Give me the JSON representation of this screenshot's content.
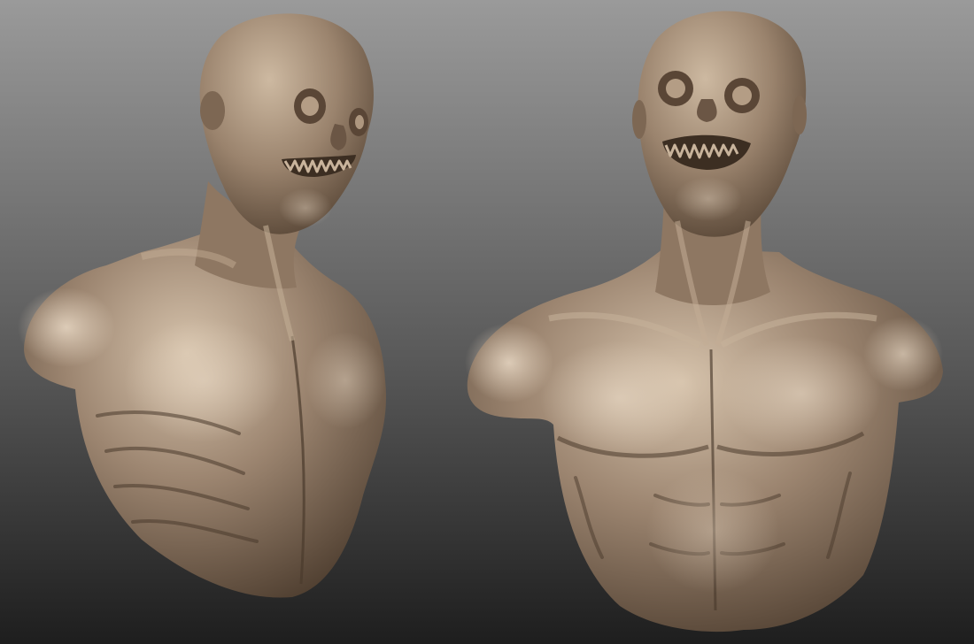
{
  "scene": {
    "background_top": "#9a9a9a",
    "background_bottom": "#1e1e1e",
    "clay_base": "#9c8570",
    "clay_highlight": "#d6c3ac",
    "clay_shadow": "#4a3a2c"
  },
  "figures": [
    {
      "name": "creature-bust-three-quarter-view"
    },
    {
      "name": "creature-bust-front-view"
    }
  ]
}
